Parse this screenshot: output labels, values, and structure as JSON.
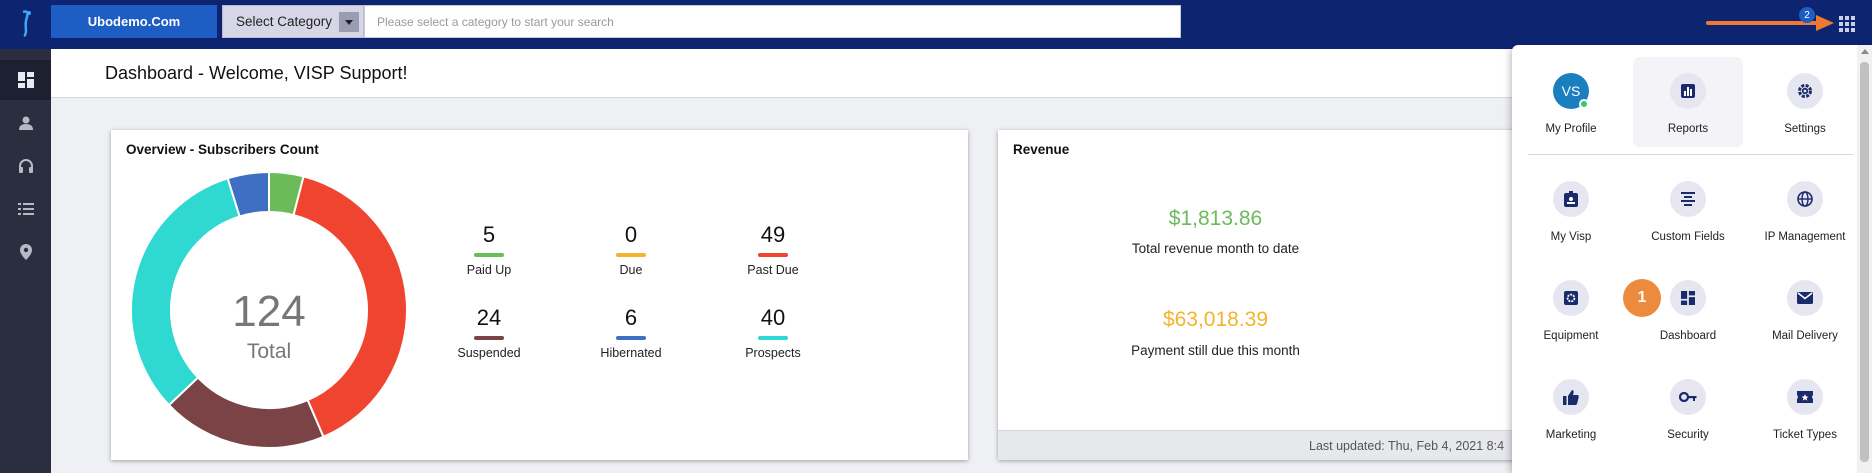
{
  "topbar": {
    "org_label": "Ubodemo.Com",
    "category_selected": "Select Category",
    "search_placeholder": "Please select a category to start your search",
    "notification_count": "2",
    "accent_color": "#0d2470",
    "annotation_arrow_color": "#ef7a2f"
  },
  "sidebar": {
    "items": [
      {
        "icon": "dashboard-icon",
        "active": true
      },
      {
        "icon": "person-icon",
        "active": false
      },
      {
        "icon": "headset-icon",
        "active": false
      },
      {
        "icon": "list-icon",
        "active": false
      },
      {
        "icon": "location-pin-icon",
        "active": false
      }
    ]
  },
  "header": {
    "title": "Dashboard - Welcome, VISP Support!"
  },
  "overview": {
    "title": "Overview - Subscribers Count",
    "total_value": "124",
    "total_label": "Total",
    "stats": [
      {
        "value": "5",
        "label": "Paid Up",
        "color": "#6cbb5a"
      },
      {
        "value": "0",
        "label": "Due",
        "color": "#f3b42c"
      },
      {
        "value": "49",
        "label": "Past Due",
        "color": "#ef4530"
      },
      {
        "value": "24",
        "label": "Suspended",
        "color": "#7a4446"
      },
      {
        "value": "6",
        "label": "Hibernated",
        "color": "#3e6fc3"
      },
      {
        "value": "40",
        "label": "Prospects",
        "color": "#30d8d2"
      }
    ]
  },
  "revenue": {
    "title": "Revenue",
    "month_to_date_value": "$1,813.86",
    "month_to_date_label": "Total revenue month to date",
    "month_to_date_color": "#6cbb5a",
    "due_value": "$63,018.39",
    "due_label": "Payment still due this month",
    "due_color": "#f3b42c",
    "footer": "Last updated: Thu, Feb 4, 2021 8:4"
  },
  "apps_panel": {
    "profile_initials": "VS",
    "annotation_step": "1",
    "items": [
      {
        "label": "My Profile",
        "icon": "avatar-icon"
      },
      {
        "label": "Reports",
        "icon": "bar-chart-icon"
      },
      {
        "label": "Settings",
        "icon": "gear-icon"
      },
      {
        "label": "My Visp",
        "icon": "id-badge-icon"
      },
      {
        "label": "Custom Fields",
        "icon": "align-center-icon"
      },
      {
        "label": "IP Management",
        "icon": "globe-icon"
      },
      {
        "label": "Equipment",
        "icon": "equipment-gear-icon"
      },
      {
        "label": "Dashboard",
        "icon": "dashboard-icon"
      },
      {
        "label": "Mail Delivery",
        "icon": "mail-icon"
      },
      {
        "label": "Marketing",
        "icon": "thumbs-up-icon"
      },
      {
        "label": "Security",
        "icon": "key-icon"
      },
      {
        "label": "Ticket Types",
        "icon": "ticket-icon"
      }
    ]
  },
  "chart_data": {
    "type": "pie",
    "title": "Overview - Subscribers Count",
    "categories": [
      "Paid Up",
      "Due",
      "Past Due",
      "Suspended",
      "Hibernated",
      "Prospects"
    ],
    "values": [
      5,
      0,
      49,
      24,
      6,
      40
    ],
    "colors": [
      "#6cbb5a",
      "#f3b42c",
      "#ef4530",
      "#7a4446",
      "#3e6fc3",
      "#30d8d2"
    ],
    "center_value": 124,
    "center_label": "Total"
  }
}
